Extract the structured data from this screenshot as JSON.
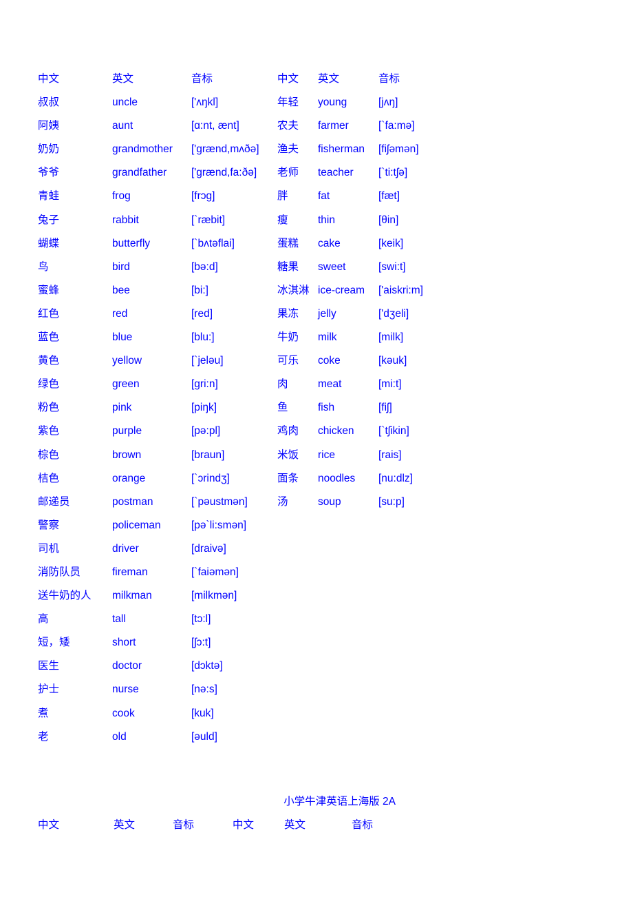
{
  "document": {
    "footer_title": "小学牛津英语上海版 2A",
    "text_color": "#0000ff",
    "background_color": "#ffffff"
  },
  "headers": {
    "chinese": "中文",
    "english": "英文",
    "phonetic": "音标"
  },
  "footer_headers": {
    "chinese_1": "中文",
    "english_1": "英文",
    "phonetic_1": "音标",
    "chinese_2": "中文",
    "english_2": "英文",
    "phonetic_2": "音标"
  },
  "rows": [
    {
      "cn1": "叔叔",
      "en1": "uncle",
      "ip1": "['ʌŋkl]",
      "cn2": "年轻",
      "en2": "young",
      "ip2": "[jʌŋ]"
    },
    {
      "cn1": "阿姨",
      "en1": "aunt",
      "ip1": "[ɑ:nt, ænt]",
      "cn2": "农夫",
      "en2": "farmer",
      "ip2": "[`fa:mə]"
    },
    {
      "cn1": "奶奶",
      "en1": "grandmother",
      "ip1": "['grænd,mʌðə]",
      "cn2": "渔夫",
      "en2": "fisherman",
      "ip2": "[fiʃəmən]"
    },
    {
      "cn1": "爷爷",
      "en1": "grandfather",
      "ip1": "['grænd,fa:ðə]",
      "cn2": "老师",
      "en2": "teacher",
      "ip2": "[`ti:tʃə]"
    },
    {
      "cn1": "青蛙",
      "en1": "frog",
      "ip1": "[frɔg]",
      "cn2": "胖",
      "en2": "fat",
      "ip2": "[fæt]"
    },
    {
      "cn1": "兔子",
      "en1": "rabbit",
      "ip1": "[`ræbit]",
      "cn2": "瘦",
      "en2": "thin",
      "ip2": "[θin]"
    },
    {
      "cn1": "蝴蝶",
      "en1": "butterfly",
      "ip1": "[`bʌtəflai]",
      "cn2": "蛋糕",
      "en2": "cake",
      "ip2": "[keik]"
    },
    {
      "cn1": "鸟",
      "en1": "bird",
      "ip1": "[bə:d]",
      "cn2": "糖果",
      "en2": "sweet",
      "ip2": "[swi:t]"
    },
    {
      "cn1": "蜜蜂",
      "en1": "bee",
      "ip1": "[bi:]",
      "cn2": "冰淇淋",
      "en2": "ice-cream",
      "ip2": "['aiskri:m]"
    },
    {
      "cn1": "红色",
      "en1": "red",
      "ip1": "[red]",
      "cn2": "果冻",
      "en2": "jelly",
      "ip2": "['dʒeli]"
    },
    {
      "cn1": "蓝色",
      "en1": "blue",
      "ip1": "[blu:]",
      "cn2": "牛奶",
      "en2": "milk",
      "ip2": "[milk]"
    },
    {
      "cn1": "黄色",
      "en1": "yellow",
      "ip1": "[`jeləu]",
      "cn2": "可乐",
      "en2": "coke",
      "ip2": "[kəuk]"
    },
    {
      "cn1": "绿色",
      "en1": "green",
      "ip1": "[gri:n]",
      "cn2": "肉",
      "en2": "meat",
      "ip2": "[mi:t]"
    },
    {
      "cn1": "粉色",
      "en1": "pink",
      "ip1": "[piŋk]",
      "cn2": "鱼",
      "en2": "fish",
      "ip2": "[fiʃ]"
    },
    {
      "cn1": "紫色",
      "en1": "purple",
      "ip1": "[pə:pl]",
      "cn2": "鸡肉",
      "en2": "chicken",
      "ip2": "[`tʃikin]"
    },
    {
      "cn1": "棕色",
      "en1": "brown",
      "ip1": "[braun]",
      "cn2": "米饭",
      "en2": "rice",
      "ip2": "[rais]"
    },
    {
      "cn1": "桔色",
      "en1": "orange",
      "ip1": "[`ɔrindʒ]",
      "cn2": "面条",
      "en2": "noodles",
      "ip2": "[nu:dlz]"
    },
    {
      "cn1": "邮递员",
      "en1": "postman",
      "ip1": "[`pəustmən]",
      "cn2": "汤",
      "en2": "soup",
      "ip2": "[su:p]"
    },
    {
      "cn1": "警察",
      "en1": "policeman",
      "ip1": "[pə`li:smən]",
      "cn2": "",
      "en2": "",
      "ip2": ""
    },
    {
      "cn1": "司机",
      "en1": "driver",
      "ip1": "[draivə]",
      "cn2": "",
      "en2": "",
      "ip2": ""
    },
    {
      "cn1": "消防队员",
      "en1": "fireman",
      "ip1": "[`faiəmən]",
      "cn2": "",
      "en2": "",
      "ip2": ""
    },
    {
      "cn1": "送牛奶的人",
      "en1": "milkman",
      "ip1": "[milkmən]",
      "cn2": "",
      "en2": "",
      "ip2": ""
    },
    {
      "cn1": "高",
      "en1": "tall",
      "ip1": "[tɔ:l]",
      "cn2": "",
      "en2": "",
      "ip2": ""
    },
    {
      "cn1": "短，矮",
      "en1": "short",
      "ip1": "[ʃɔ:t]",
      "cn2": "",
      "en2": "",
      "ip2": ""
    },
    {
      "cn1": "医生",
      "en1": "doctor",
      "ip1": "[dɔktə]",
      "cn2": "",
      "en2": "",
      "ip2": ""
    },
    {
      "cn1": "护士",
      "en1": "nurse",
      "ip1": "[nə:s]",
      "cn2": "",
      "en2": "",
      "ip2": ""
    },
    {
      "cn1": "煮",
      "en1": "cook",
      "ip1": "[kuk]",
      "cn2": "",
      "en2": "",
      "ip2": ""
    },
    {
      "cn1": "老",
      "en1": "old",
      "ip1": "[əuld]",
      "cn2": "",
      "en2": "",
      "ip2": ""
    }
  ]
}
